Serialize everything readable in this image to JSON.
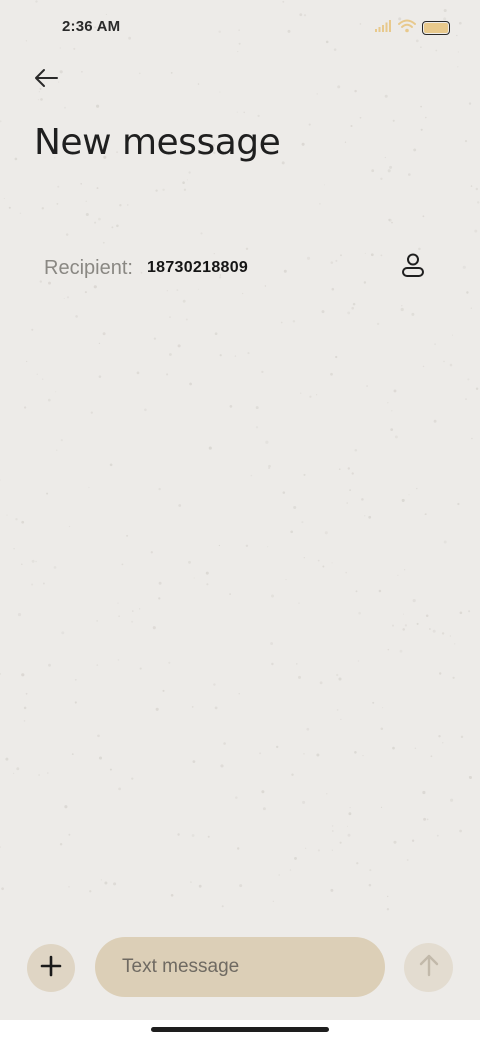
{
  "status_bar": {
    "time": "2:36 AM",
    "icons": [
      "signal-icon",
      "wifi-icon",
      "battery-icon"
    ],
    "battery_level": 1.0,
    "accent_color": "#e8c98c"
  },
  "header": {
    "back_icon": "arrow-left-icon",
    "title": "New message"
  },
  "recipient": {
    "label": "Recipient:",
    "value": "18730218809",
    "picker_icon": "person-icon"
  },
  "composer": {
    "attach_icon": "plus-icon",
    "placeholder": "Text message",
    "send_icon": "arrow-up-icon"
  },
  "colors": {
    "background": "#edebe8",
    "input_fill": "#dccfb7",
    "button_fill": "#dfd5c4"
  }
}
